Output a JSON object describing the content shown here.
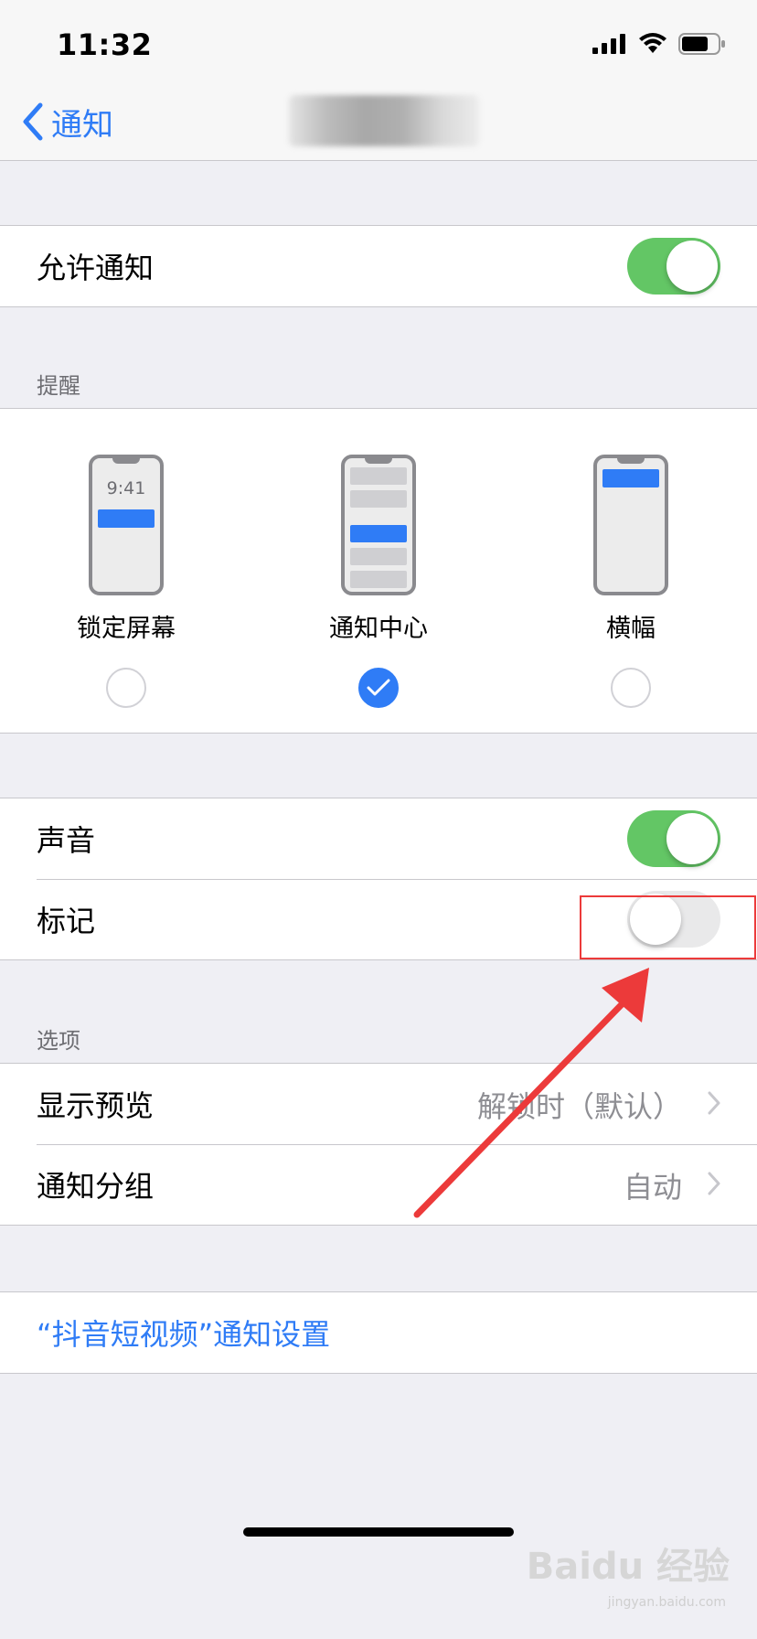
{
  "status_bar": {
    "time": "11:32"
  },
  "nav": {
    "back_label": "通知"
  },
  "allow_notifications": {
    "label": "允许通知",
    "on": true
  },
  "alerts": {
    "header": "提醒",
    "styles": [
      {
        "label": "锁定屏幕",
        "preview_time": "9:41",
        "selected": false
      },
      {
        "label": "通知中心",
        "selected": true
      },
      {
        "label": "横幅",
        "selected": false
      }
    ]
  },
  "sounds": {
    "label": "声音",
    "on": true
  },
  "badges": {
    "label": "标记",
    "on": false
  },
  "options": {
    "header": "选项",
    "show_previews": {
      "label": "显示预览",
      "value": "解锁时（默认）"
    },
    "notification_grouping": {
      "label": "通知分组",
      "value": "自动"
    }
  },
  "app_settings_link": "“抖音短视频”通知设置",
  "watermark": {
    "brand": "Baidu 经验",
    "url": "jingyan.baidu.com"
  },
  "colors": {
    "accent": "#2f7cf6",
    "toggle_on": "#63c665",
    "annotation": "#ec3a3a"
  }
}
